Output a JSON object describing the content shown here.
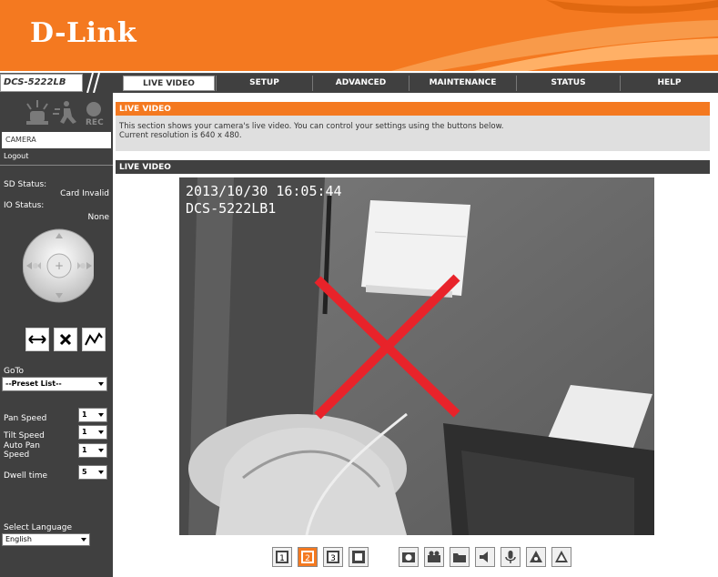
{
  "brand": {
    "logo": "D-Link",
    "model": "DCS-5222LB"
  },
  "nav": {
    "tabs": [
      {
        "label": "LIVE VIDEO",
        "active": true
      },
      {
        "label": "SETUP"
      },
      {
        "label": "ADVANCED"
      },
      {
        "label": "MAINTENANCE"
      },
      {
        "label": "STATUS"
      },
      {
        "label": "HELP"
      }
    ]
  },
  "sidebar": {
    "rec_label": "REC",
    "camera_label": "CAMERA",
    "logout_label": "Logout",
    "sd_status_label": "SD Status:",
    "sd_status_value": "Card Invalid",
    "io_status_label": "IO Status:",
    "io_status_value": "None",
    "goto_label": "GoTo",
    "preset_value": "--Preset List--",
    "pan_speed_label": "Pan Speed",
    "pan_speed_value": "1",
    "tilt_speed_label": "Tilt Speed",
    "tilt_speed_value": "1",
    "auto_pan_label_1": "Auto Pan",
    "auto_pan_label_2": "Speed",
    "auto_pan_value": "1",
    "dwell_label": "Dwell time",
    "dwell_value": "5",
    "language_label": "Select Language",
    "language_value": "English"
  },
  "main": {
    "section_title": "LIVE VIDEO",
    "desc_line1": "This section shows your camera's live video. You can control your settings using the buttons below.",
    "desc_line2": "Current resolution is 640 x 480.",
    "video_header": "LIVE VIDEO",
    "overlay_timestamp": "2013/10/30 16:05:44",
    "overlay_name": "DCS-5222LB1"
  },
  "colors": {
    "accent": "#f47920",
    "dark": "#404040",
    "cross": "#e8232a"
  },
  "toolbar": {
    "icons": [
      "profile-1-icon",
      "profile-2-icon",
      "profile-3-icon",
      "fullscreen-icon",
      "snapshot-icon",
      "record-icon",
      "folder-icon",
      "speaker-icon",
      "microphone-icon",
      "digital-output-icon"
    ],
    "active_profile": "2"
  }
}
